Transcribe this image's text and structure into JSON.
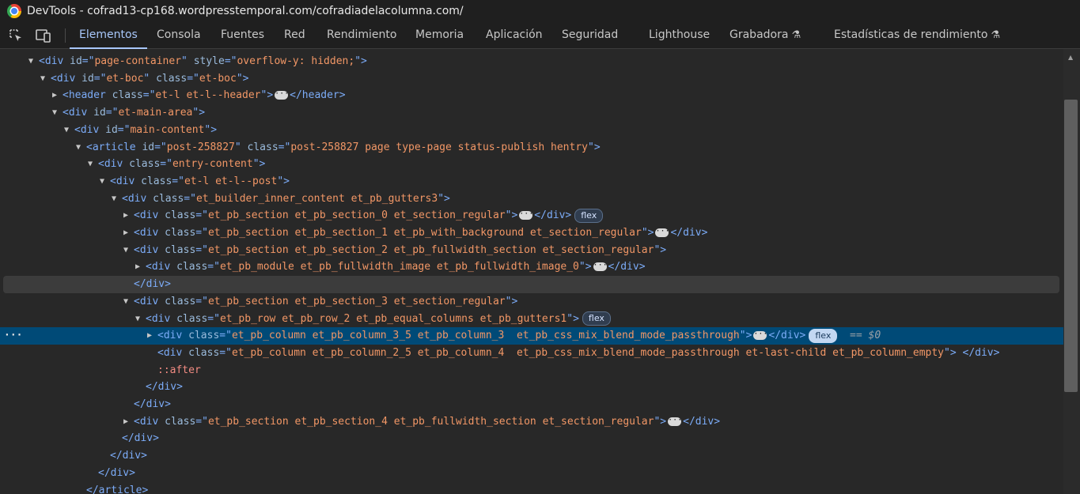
{
  "window": {
    "title": "DevTools - cofrad13-cp168.wordpresstemporal.com/cofradiadelacolumna.com/"
  },
  "toolbar": {
    "inspect_icon": "inspect-element-icon",
    "device_icon": "device-toolbar-icon",
    "tabs": [
      {
        "label": "Elementos",
        "active": true
      },
      {
        "label": "Consola"
      },
      {
        "label": "Fuentes"
      },
      {
        "label": "Red"
      },
      {
        "label": "Rendimiento"
      },
      {
        "label": "Memoria"
      },
      {
        "label": "Aplicación"
      },
      {
        "label": "Seguridad"
      },
      {
        "label": "Lighthouse"
      },
      {
        "label": "Grabadora",
        "flask": true
      },
      {
        "label": "Estadísticas de rendimiento",
        "flask": true
      }
    ]
  },
  "dom_tree": [
    {
      "depth": 0,
      "tri": "open",
      "open": "div",
      "attrs": [
        [
          "id",
          "page-container"
        ],
        [
          "style",
          "overflow-y: hidden;"
        ]
      ]
    },
    {
      "depth": 1,
      "tri": "open",
      "open": "div",
      "attrs": [
        [
          "id",
          "et-boc"
        ],
        [
          "class",
          "et-boc"
        ]
      ]
    },
    {
      "depth": 2,
      "tri": "closed",
      "open": "header",
      "attrs": [
        [
          "class",
          "et-l et-l--header"
        ]
      ],
      "ellipsis": true,
      "close": "header"
    },
    {
      "depth": 2,
      "tri": "open",
      "open": "div",
      "attrs": [
        [
          "id",
          "et-main-area"
        ]
      ]
    },
    {
      "depth": 3,
      "tri": "open",
      "open": "div",
      "attrs": [
        [
          "id",
          "main-content"
        ]
      ]
    },
    {
      "depth": 4,
      "tri": "open",
      "open": "article",
      "attrs": [
        [
          "id",
          "post-258827"
        ],
        [
          "class",
          "post-258827 page type-page status-publish hentry"
        ]
      ]
    },
    {
      "depth": 5,
      "tri": "open",
      "open": "div",
      "attrs": [
        [
          "class",
          "entry-content"
        ]
      ]
    },
    {
      "depth": 6,
      "tri": "open",
      "open": "div",
      "attrs": [
        [
          "class",
          "et-l et-l--post"
        ]
      ]
    },
    {
      "depth": 7,
      "tri": "open",
      "open": "div",
      "attrs": [
        [
          "class",
          "et_builder_inner_content et_pb_gutters3"
        ]
      ]
    },
    {
      "depth": 8,
      "tri": "closed",
      "open": "div",
      "attrs": [
        [
          "class",
          "et_pb_section et_pb_section_0 et_section_regular"
        ]
      ],
      "ellipsis": true,
      "close": "div",
      "badge": "flex"
    },
    {
      "depth": 8,
      "tri": "closed",
      "open": "div",
      "attrs": [
        [
          "class",
          "et_pb_section et_pb_section_1 et_pb_with_background et_section_regular"
        ]
      ],
      "ellipsis": true,
      "close": "div"
    },
    {
      "depth": 8,
      "tri": "open",
      "open": "div",
      "attrs": [
        [
          "class",
          "et_pb_section et_pb_section_2 et_pb_fullwidth_section et_section_regular"
        ]
      ]
    },
    {
      "depth": 9,
      "tri": "closed",
      "open": "div",
      "attrs": [
        [
          "class",
          "et_pb_module et_pb_fullwidth_image et_pb_fullwidth_image_0"
        ]
      ],
      "ellipsis": true,
      "close": "div"
    },
    {
      "depth": 8,
      "close_only": "div",
      "state": "hover"
    },
    {
      "depth": 8,
      "tri": "open",
      "open": "div",
      "attrs": [
        [
          "class",
          "et_pb_section et_pb_section_3 et_section_regular"
        ]
      ]
    },
    {
      "depth": 9,
      "tri": "open",
      "open": "div",
      "attrs": [
        [
          "class",
          "et_pb_row et_pb_row_2 et_pb_equal_columns et_pb_gutters1"
        ]
      ],
      "badge": "flex"
    },
    {
      "depth": 10,
      "tri": "closed",
      "open": "div",
      "attrs": [
        [
          "class",
          "et_pb_column et_pb_column_3_5 et_pb_column_3  et_pb_css_mix_blend_mode_passthrough"
        ]
      ],
      "ellipsis": true,
      "close": "div",
      "badge": "flex",
      "suffix": "== $0",
      "state": "selected"
    },
    {
      "depth": 10,
      "open": "div",
      "attrs": [
        [
          "class",
          "et_pb_column et_pb_column_2_5 et_pb_column_4  et_pb_css_mix_blend_mode_passthrough et-last-child et_pb_column_empty"
        ]
      ],
      "close": "div",
      "gap": " "
    },
    {
      "depth": 10,
      "pseudo": "::after"
    },
    {
      "depth": 9,
      "close_only": "div"
    },
    {
      "depth": 8,
      "close_only": "div"
    },
    {
      "depth": 8,
      "tri": "closed",
      "open": "div",
      "attrs": [
        [
          "class",
          "et_pb_section et_pb_section_4 et_pb_fullwidth_section et_section_regular"
        ]
      ],
      "ellipsis": true,
      "close": "div"
    },
    {
      "depth": 7,
      "close_only": "div"
    },
    {
      "depth": 6,
      "close_only": "div"
    },
    {
      "depth": 5,
      "close_only": "div"
    },
    {
      "depth": 4,
      "close_only": "article"
    }
  ]
}
